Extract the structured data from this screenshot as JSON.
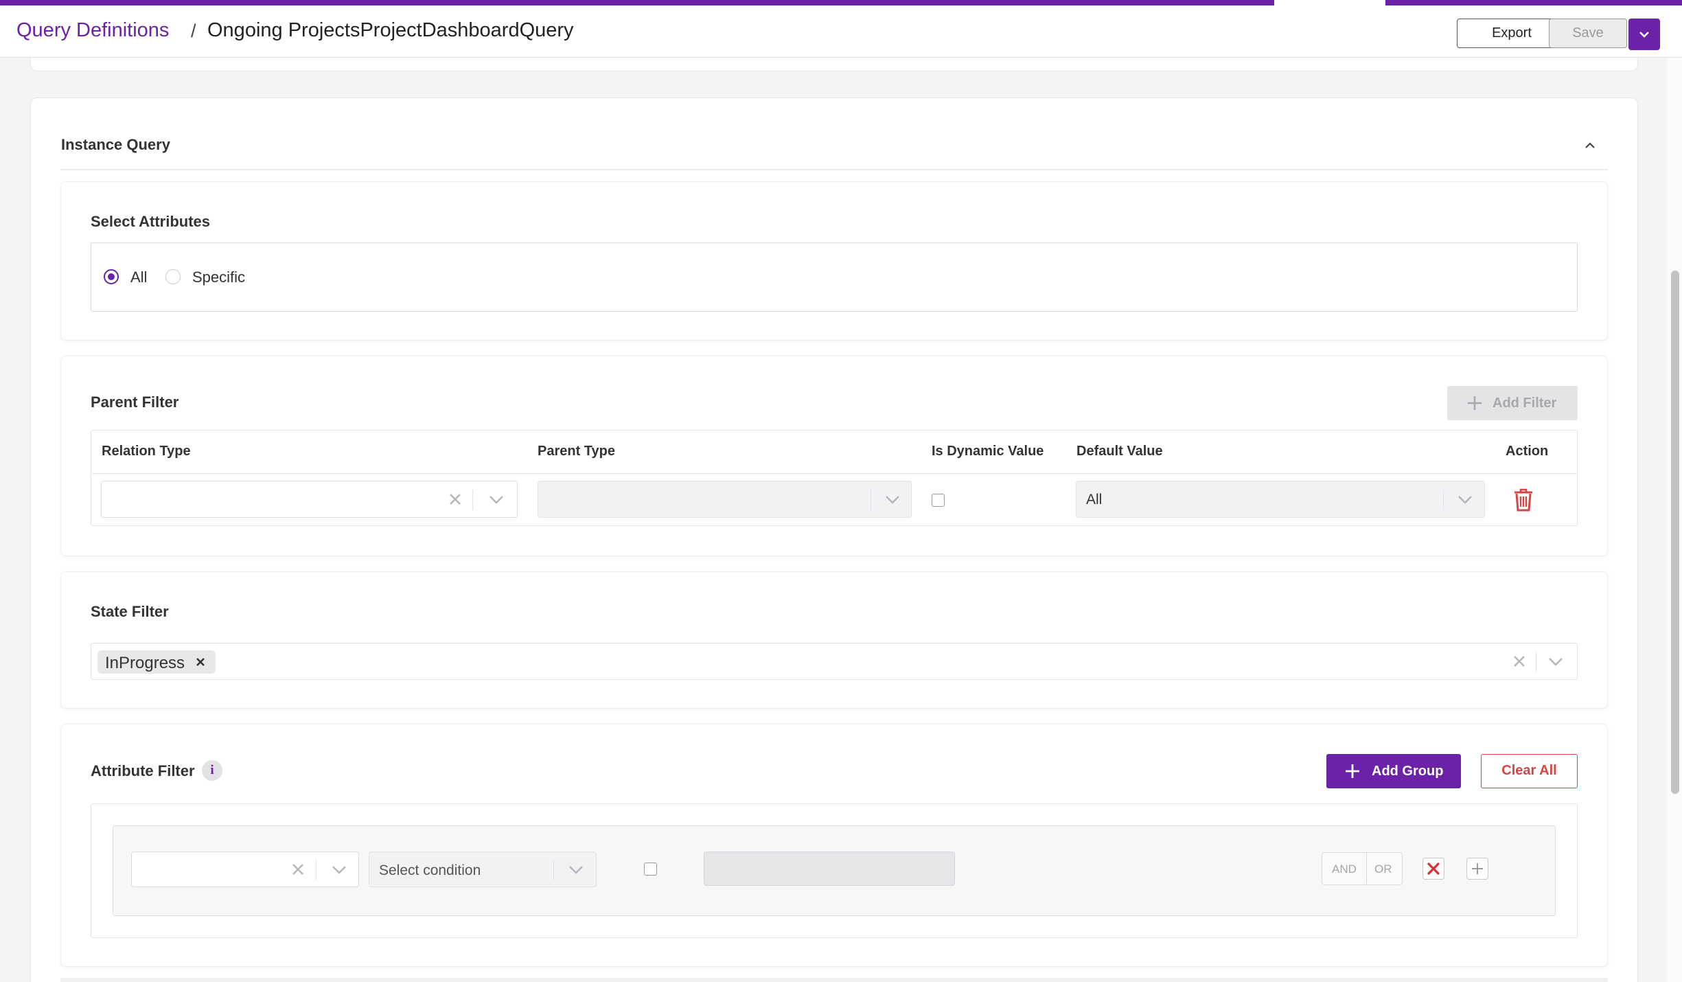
{
  "breadcrumb": {
    "parent": "Query Definitions",
    "separator": "/",
    "current": "Ongoing ProjectsProjectDashboardQuery"
  },
  "toolbar": {
    "export_label": "Export",
    "save_label": "Save"
  },
  "instance_query": {
    "title": "Instance Query",
    "expanded": true
  },
  "select_attributes": {
    "title": "Select Attributes",
    "options": [
      {
        "label": "All",
        "selected": true
      },
      {
        "label": "Specific",
        "selected": false
      }
    ]
  },
  "parent_filter": {
    "title": "Parent Filter",
    "add_filter_label": "Add Filter",
    "columns": [
      "Relation Type",
      "Parent Type",
      "Is Dynamic Value",
      "Default Value",
      "Action"
    ],
    "row": {
      "relation_type": "",
      "parent_type": "",
      "is_dynamic": false,
      "default_value": "All"
    }
  },
  "state_filter": {
    "title": "State Filter",
    "chips": [
      "InProgress"
    ]
  },
  "attribute_filter": {
    "title": "Attribute Filter",
    "info_icon": "i",
    "add_group_label": "Add Group",
    "clear_all_label": "Clear All",
    "row": {
      "attribute": "",
      "condition_placeholder": "Select condition",
      "value": "",
      "and_label": "AND",
      "or_label": "OR"
    }
  },
  "colors": {
    "accent": "#6b21a8",
    "danger": "#d64545"
  }
}
